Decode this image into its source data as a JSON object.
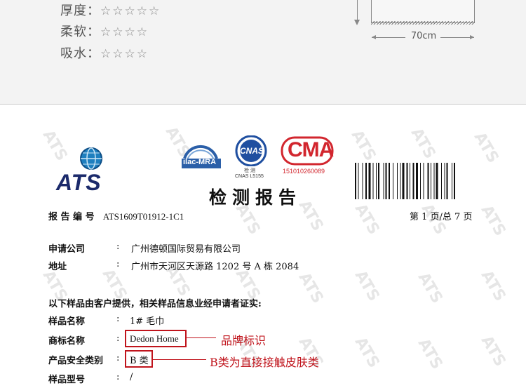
{
  "product_ratings": [
    {
      "label": "厚度",
      "separator": "：",
      "stars": "☆☆☆☆☆"
    },
    {
      "label": "柔软",
      "separator": "：",
      "stars": "☆☆☆☆"
    },
    {
      "label": "吸水",
      "separator": "：",
      "stars": "☆☆☆☆"
    }
  ],
  "size_diagram": {
    "width_label": "70cm"
  },
  "report": {
    "watermark": "ATS",
    "logo_text": "ATS",
    "cert_ilac": "ilac-MRA",
    "cert_cnas": "CNAS",
    "cert_cnas_sub": "检 测",
    "cert_cnas_code": "CNAS L5155",
    "cert_cma": "CMA",
    "cert_cma_code": "151010260089",
    "title": "检测报告",
    "report_no_label": "报 告 编 号",
    "report_no": "ATS1609T01912-1C1",
    "page_info": "第 1 页/总 7 页",
    "applicant_label": "申请公司",
    "applicant": "广州德顿国际贸易有限公司",
    "address_label": "地址",
    "address": "广州市天河区天源路 1202 号 A 栋 2084",
    "colon": ":",
    "intro": "以下样品由客户提供，相关样品信息业经申请者证实:",
    "sample_name_label": "样品名称",
    "sample_name": "1# 毛巾",
    "brand_label": "商标名称",
    "brand": "Dedon Home",
    "safety_label": "产品安全类别",
    "safety": "B 类",
    "model_label": "样品型号",
    "model": "/"
  },
  "annotations": {
    "brand_note": "品牌标识",
    "safety_note": "B类为直接接触皮肤类"
  },
  "colors": {
    "annotation_red": "#c0141c",
    "ats_blue": "#1b2a6b"
  }
}
